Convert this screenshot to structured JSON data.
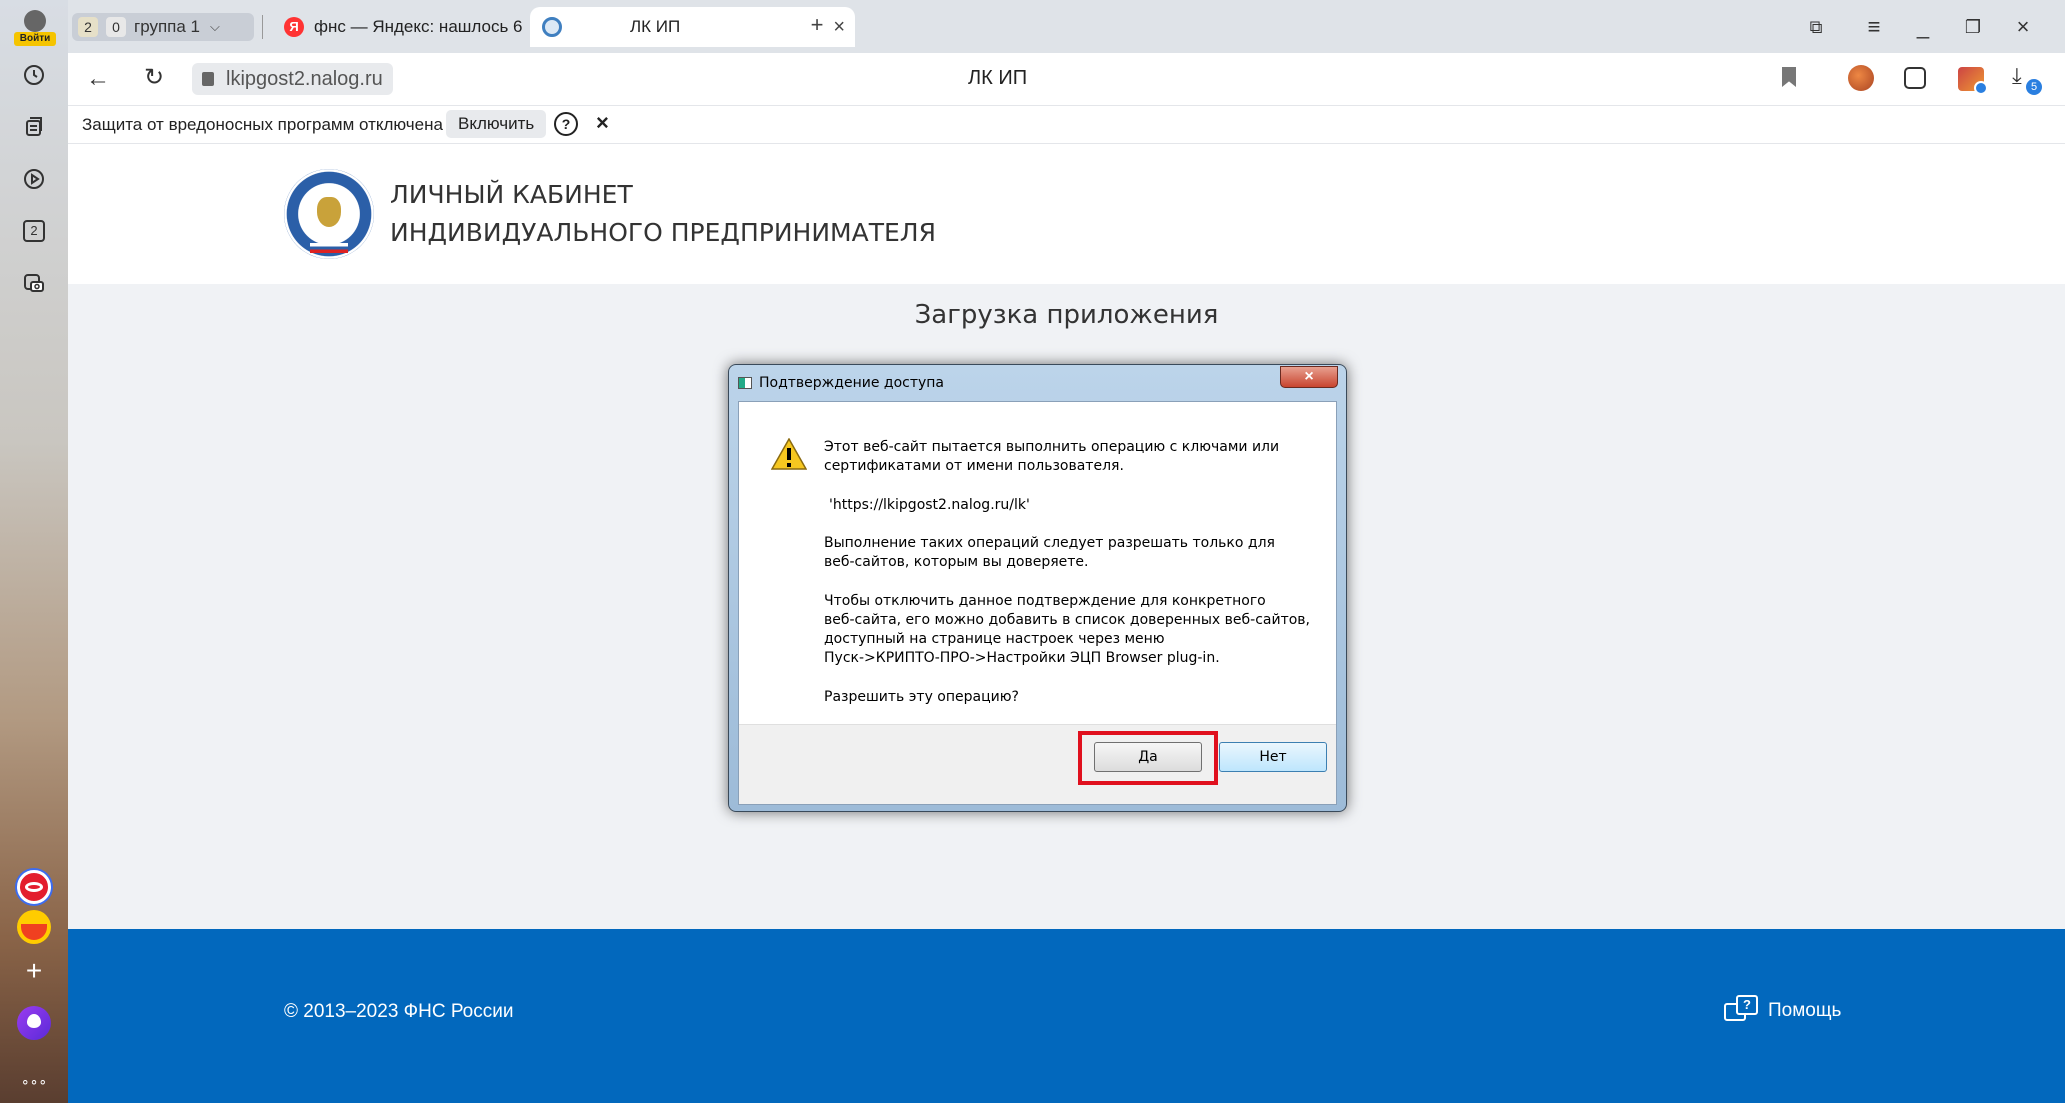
{
  "sidebar": {
    "login_label": "Войти",
    "badge_count": "2"
  },
  "tabs": {
    "group_count_a": "2",
    "group_count_b": "0",
    "group_name": "группа 1",
    "tab1_title": "фнс — Яндекс: нашлось 6",
    "tab2_title": "ЛК ИП"
  },
  "address": {
    "url": "lkipgost2.nalog.ru",
    "page_title": "ЛК ИП",
    "downloads_badge": "5"
  },
  "protect": {
    "message": "Защита от вредоносных программ отключена",
    "enable_label": "Включить",
    "help_glyph": "?",
    "close_glyph": "×"
  },
  "site": {
    "title_line1": "ЛИЧНЫЙ КАБИНЕТ",
    "title_line2": "ИНДИВИДУАЛЬНОГО ПРЕДПРИНИМАТЕЛЯ",
    "loading": "Загрузка приложения",
    "copyright": "© 2013–2023 ФНС России",
    "help": "Помощь"
  },
  "dialog": {
    "title": "Подтверждение доступа",
    "p1": "Этот веб-сайт пытается выполнить операцию с ключами или\nсертификатами от имени пользователя.",
    "url": "'https://lkipgost2.nalog.ru/lk'",
    "p2": "Выполнение таких операций следует разрешать только для\nвеб-сайтов, которым вы доверяете.",
    "p3": "Чтобы отключить данное подтверждение для конкретного\nвеб-сайта, его можно добавить в список доверенных веб-сайтов,\nдоступный на странице настроек через меню\nПуск->КРИПТО-ПРО->Настройки ЭЦП Browser plug-in.",
    "question": "Разрешить эту операцию?",
    "yes": "Да",
    "no": "Нет"
  },
  "colors": {
    "footer_blue": "#0268bd",
    "highlight_red": "#e0101e"
  }
}
